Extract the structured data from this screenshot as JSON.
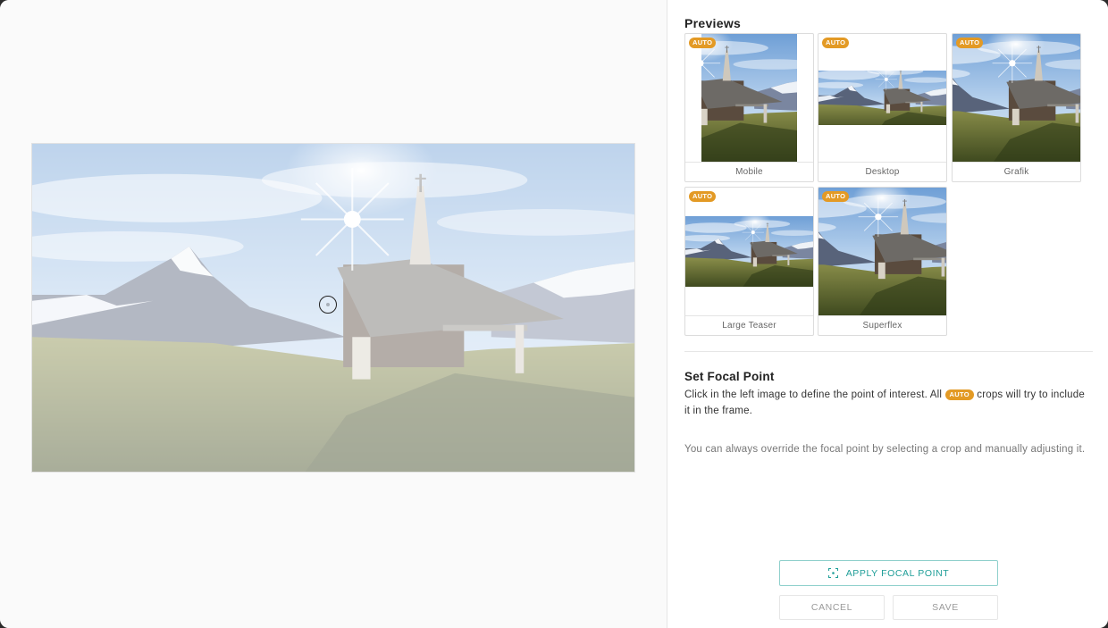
{
  "panel": {
    "title": "Previews",
    "auto_badge": "AUTO",
    "previews": [
      {
        "label": "Mobile",
        "auto": true
      },
      {
        "label": "Desktop",
        "auto": true
      },
      {
        "label": "Grafik",
        "auto": true
      },
      {
        "label": "Large Teaser",
        "auto": true
      },
      {
        "label": "Superflex",
        "auto": true
      }
    ]
  },
  "focal": {
    "title": "Set Focal Point",
    "desc_before": "Click in the left image to define the point of interest. All ",
    "desc_badge": "AUTO",
    "desc_after": " crops will try to include it in the frame.",
    "note": "You can always override the focal point by selecting a crop and manually adjusting it."
  },
  "buttons": {
    "apply": "APPLY FOCAL POINT",
    "cancel": "CANCEL",
    "save": "SAVE"
  },
  "colors": {
    "accent": "#1f9e98",
    "auto_badge": "#e39a25"
  }
}
